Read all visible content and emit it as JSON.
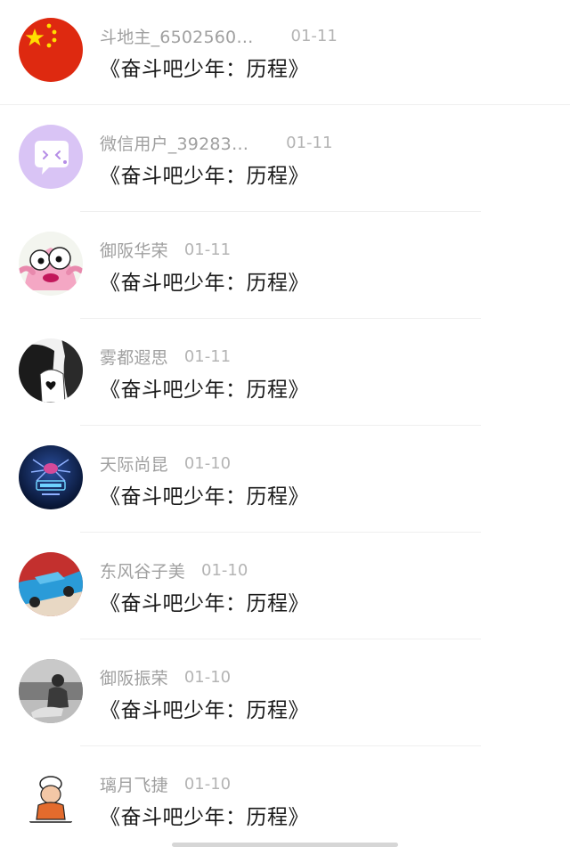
{
  "conversations": [
    {
      "username": "斗地主_6502560…",
      "date": "01-11",
      "message": "《奋斗吧少年：历程》",
      "avatar": "china-flag-avatar"
    },
    {
      "username": "微信用户_39283…",
      "date": "01-11",
      "message": "《奋斗吧少年：历程》",
      "avatar": "purple-chat-bubble-avatar"
    },
    {
      "username": "御阪华荣",
      "date": "01-11",
      "message": "《奋斗吧少年：历程》",
      "avatar": "pink-starfish-cartoon-avatar"
    },
    {
      "username": "雾都遐思",
      "date": "01-11",
      "message": "《奋斗吧少年：历程》",
      "avatar": "black-white-girl-heart-avatar"
    },
    {
      "username": "天际尚昆",
      "date": "01-10",
      "message": "《奋斗吧少年：历程》",
      "avatar": "dark-blue-spider-logo-avatar"
    },
    {
      "username": "东风谷子美",
      "date": "01-10",
      "message": "《奋斗吧少年：历程》",
      "avatar": "blue-car-photo-avatar"
    },
    {
      "username": "御阪振荣",
      "date": "01-10",
      "message": "《奋斗吧少年：历程》",
      "avatar": "grayscale-person-beach-photo-avatar"
    },
    {
      "username": "璃月飞捷",
      "date": "01-10",
      "message": "《奋斗吧少年：历程》",
      "avatar": "cartoon-swimmer-sticker-avatar"
    }
  ],
  "avatar_colors": {
    "flag_red": "#de2910",
    "flag_yellow": "#ffde00",
    "purple": "#c9a6f2",
    "pink": "#f4a7c4",
    "navy": "#0d1f4a"
  }
}
